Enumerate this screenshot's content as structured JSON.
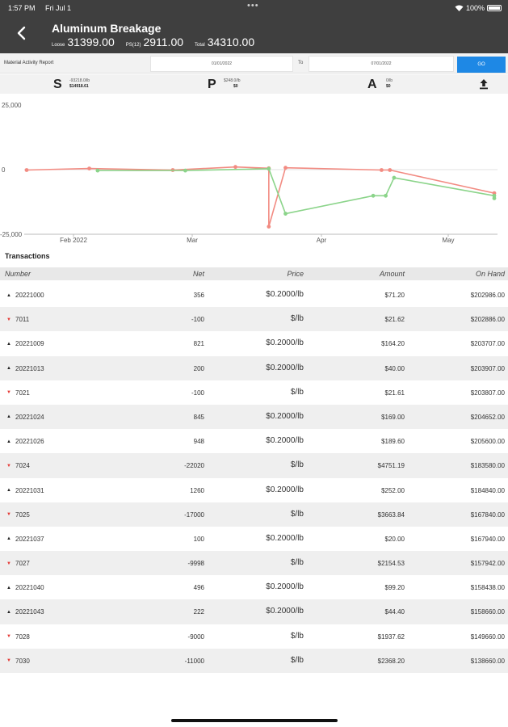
{
  "status": {
    "time": "1:57 PM",
    "date": "Fri Jul 1",
    "dots": "•••",
    "battery": "100%"
  },
  "header": {
    "title": "Aluminum Breakage",
    "totals": [
      {
        "label": "Loose",
        "value": "31399.00"
      },
      {
        "label": "PS(12)",
        "value": "2911.00"
      },
      {
        "label": "Total",
        "value": "34310.00"
      }
    ]
  },
  "report": {
    "label": "Material Activity Report",
    "from": "01/01/2022",
    "to_label": "To",
    "to": "07/01/2022",
    "go": "GO"
  },
  "summary": [
    {
      "letter": "S",
      "line1": "-93218.0/lb",
      "line2": "$14918.61"
    },
    {
      "letter": "P",
      "line1": "$248.0/lb",
      "line2": "$0"
    },
    {
      "letter": "A",
      "line1": "0/lb",
      "line2": "$0"
    }
  ],
  "chart_data": {
    "type": "line",
    "ylim": [
      -25000,
      25000
    ],
    "yticks": [
      "25,000",
      "0",
      "-25,000"
    ],
    "xticks": [
      "Feb 2022",
      "Mar",
      "Apr",
      "May"
    ],
    "grid": false,
    "series": [
      {
        "color": "#f28b82",
        "points": [
          [
            0,
            0
          ],
          [
            15,
            600
          ],
          [
            35,
            0
          ],
          [
            50,
            1200
          ],
          [
            58,
            700
          ],
          [
            58,
            -22020
          ],
          [
            62,
            900
          ],
          [
            85,
            0
          ],
          [
            87,
            0
          ],
          [
            112,
            -9000
          ]
        ]
      },
      {
        "color": "#8bd48a",
        "points": [
          [
            17,
            -200
          ],
          [
            38,
            -200
          ],
          [
            58,
            500
          ],
          [
            62,
            -17000
          ],
          [
            83,
            -9998
          ],
          [
            86,
            -9998
          ],
          [
            88,
            -3000
          ],
          [
            112,
            -10000
          ],
          [
            112,
            -11000
          ]
        ]
      }
    ]
  },
  "transactions": {
    "title": "Transactions",
    "columns": [
      "Number",
      "Net",
      "Price",
      "Amount",
      "On Hand"
    ],
    "rows": [
      {
        "dir": "up",
        "number": "20221000",
        "net": "356",
        "price": "$0.2000/lb",
        "amount": "$71.20",
        "onhand": "$202986.00"
      },
      {
        "dir": "down",
        "number": "7011",
        "net": "-100",
        "price": "$/lb",
        "amount": "$21.62",
        "onhand": "$202886.00"
      },
      {
        "dir": "up",
        "number": "20221009",
        "net": "821",
        "price": "$0.2000/lb",
        "amount": "$164.20",
        "onhand": "$203707.00"
      },
      {
        "dir": "up",
        "number": "20221013",
        "net": "200",
        "price": "$0.2000/lb",
        "amount": "$40.00",
        "onhand": "$203907.00"
      },
      {
        "dir": "down",
        "number": "7021",
        "net": "-100",
        "price": "$/lb",
        "amount": "$21.61",
        "onhand": "$203807.00"
      },
      {
        "dir": "up",
        "number": "20221024",
        "net": "845",
        "price": "$0.2000/lb",
        "amount": "$169.00",
        "onhand": "$204652.00"
      },
      {
        "dir": "up",
        "number": "20221026",
        "net": "948",
        "price": "$0.2000/lb",
        "amount": "$189.60",
        "onhand": "$205600.00"
      },
      {
        "dir": "down",
        "number": "7024",
        "net": "-22020",
        "price": "$/lb",
        "amount": "$4751.19",
        "onhand": "$183580.00"
      },
      {
        "dir": "up",
        "number": "20221031",
        "net": "1260",
        "price": "$0.2000/lb",
        "amount": "$252.00",
        "onhand": "$184840.00"
      },
      {
        "dir": "down",
        "number": "7025",
        "net": "-17000",
        "price": "$/lb",
        "amount": "$3663.84",
        "onhand": "$167840.00"
      },
      {
        "dir": "up",
        "number": "20221037",
        "net": "100",
        "price": "$0.2000/lb",
        "amount": "$20.00",
        "onhand": "$167940.00"
      },
      {
        "dir": "down",
        "number": "7027",
        "net": "-9998",
        "price": "$/lb",
        "amount": "$2154.53",
        "onhand": "$157942.00"
      },
      {
        "dir": "up",
        "number": "20221040",
        "net": "496",
        "price": "$0.2000/lb",
        "amount": "$99.20",
        "onhand": "$158438.00"
      },
      {
        "dir": "up",
        "number": "20221043",
        "net": "222",
        "price": "$0.2000/lb",
        "amount": "$44.40",
        "onhand": "$158660.00"
      },
      {
        "dir": "down",
        "number": "7028",
        "net": "-9000",
        "price": "$/lb",
        "amount": "$1937.62",
        "onhand": "$149660.00"
      },
      {
        "dir": "down",
        "number": "7030",
        "net": "-11000",
        "price": "$/lb",
        "amount": "$2368.20",
        "onhand": "$138660.00"
      }
    ]
  }
}
